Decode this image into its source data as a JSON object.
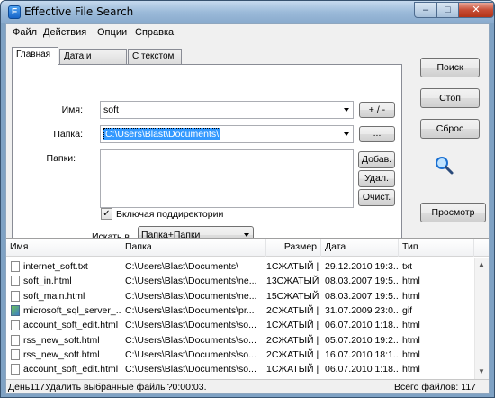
{
  "window": {
    "title": "Effective File Search",
    "app_icon_letter": "F",
    "btn_min": "–",
    "btn_max": "□",
    "btn_close": "✕"
  },
  "menu": [
    "Файл",
    "Действия",
    "Опции",
    "Справка"
  ],
  "tabs": [
    "Главная",
    "Дата и размер",
    "С текстом"
  ],
  "form": {
    "name_label": "Имя:",
    "name_value": "soft",
    "plusminus_label": "+ / -",
    "folder_label": "Папка:",
    "folder_value": "C:\\Users\\Blast\\Documents\\",
    "browse_label": "...",
    "folders_label": "Папки:",
    "add_label": "Добав.",
    "remove_label": "Удал.",
    "clear_label": "Очист.",
    "subdirs_label": "Включая поддиректории",
    "subdirs_checked": true,
    "check_mark": "✓",
    "search_in_label": "Искать в",
    "search_in_value": "Папка+Папки"
  },
  "side_buttons": {
    "search": "Поиск",
    "stop": "Стоп",
    "reset": "Сброс",
    "view": "Просмотр"
  },
  "columns": [
    "Имя",
    "Папка",
    "Размер",
    "Дата",
    "Тип"
  ],
  "rows": [
    {
      "name": "internet_soft.txt",
      "folder": "C:\\Users\\Blast\\Documents\\",
      "size": "1СЖАТЫЙ |",
      "date": "29.12.2010 19:3...",
      "type": "txt",
      "icon": "file-icon"
    },
    {
      "name": "soft_in.html",
      "folder": "C:\\Users\\Blast\\Documents\\ne...",
      "size": "13СЖАТЫЙ |",
      "date": "08.03.2007 19:5...",
      "type": "html",
      "icon": "file-icon"
    },
    {
      "name": "soft_main.html",
      "folder": "C:\\Users\\Blast\\Documents\\ne...",
      "size": "15СЖАТЫЙ |",
      "date": "08.03.2007 19:5...",
      "type": "html",
      "icon": "file-icon"
    },
    {
      "name": "microsoft_sql_server_...",
      "folder": "C:\\Users\\Blast\\Documents\\pr...",
      "size": "2СЖАТЫЙ |",
      "date": "31.07.2009 23:0...",
      "type": "gif",
      "icon": "gif-icon"
    },
    {
      "name": "account_soft_edit.html",
      "folder": "C:\\Users\\Blast\\Documents\\so...",
      "size": "1СЖАТЫЙ |",
      "date": "06.07.2010 1:18...",
      "type": "html",
      "icon": "file-icon"
    },
    {
      "name": "rss_new_soft.html",
      "folder": "C:\\Users\\Blast\\Documents\\so...",
      "size": "2СЖАТЫЙ |",
      "date": "05.07.2010 19:2...",
      "type": "html",
      "icon": "file-icon"
    },
    {
      "name": "rss_new_soft.html",
      "folder": "C:\\Users\\Blast\\Documents\\so...",
      "size": "2СЖАТЫЙ |",
      "date": "16.07.2010 18:1...",
      "type": "html",
      "icon": "file-icon"
    },
    {
      "name": "account_soft_edit.html",
      "folder": "C:\\Users\\Blast\\Documents\\so...",
      "size": "1СЖАТЫЙ |",
      "date": "06.07.2010 1:18...",
      "type": "html",
      "icon": "file-icon"
    }
  ],
  "status": {
    "left": "День117Удалить выбранные файлы?0:00:03.",
    "right": "Всего файлов: 117"
  }
}
